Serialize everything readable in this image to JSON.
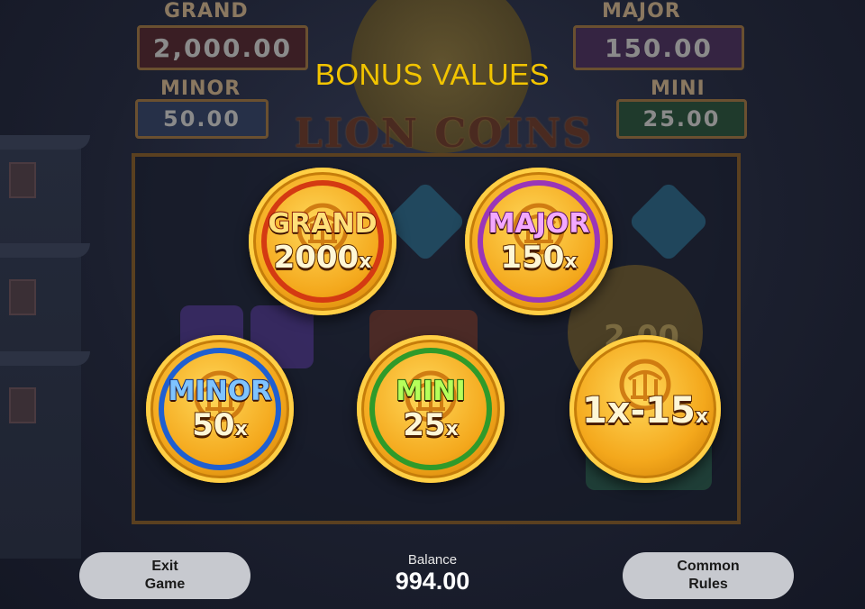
{
  "title": "BONUS VALUES",
  "background": {
    "jackpots": [
      {
        "label": "GRAND",
        "value": "2,000.00"
      },
      {
        "label": "MAJOR",
        "value": "150.00"
      },
      {
        "label": "MINOR",
        "value": "50.00"
      },
      {
        "label": "MINI",
        "value": "25.00"
      }
    ],
    "logo": "LION COINS",
    "coin_value": "2.00"
  },
  "coins": [
    {
      "name": "GRAND",
      "mult": "2000",
      "suffix": "x",
      "ring": "#d43a12"
    },
    {
      "name": "MAJOR",
      "mult": "150",
      "suffix": "x",
      "ring": "#9a36b8"
    },
    {
      "name": "MINOR",
      "mult": "50",
      "suffix": "x",
      "ring": "#1f5fd0"
    },
    {
      "name": "MINI",
      "mult": "25",
      "suffix": "x",
      "ring": "#2f9a2a"
    },
    {
      "name": "",
      "mult": "1x-15",
      "suffix": "x",
      "ring": ""
    }
  ],
  "footer": {
    "exit_label": "Exit\nGame",
    "balance_label": "Balance",
    "balance_value": "994.00",
    "rules_label": "Common\nRules"
  },
  "colors": {
    "title": "#f2c400",
    "button_bg": "#c7c9cf"
  }
}
